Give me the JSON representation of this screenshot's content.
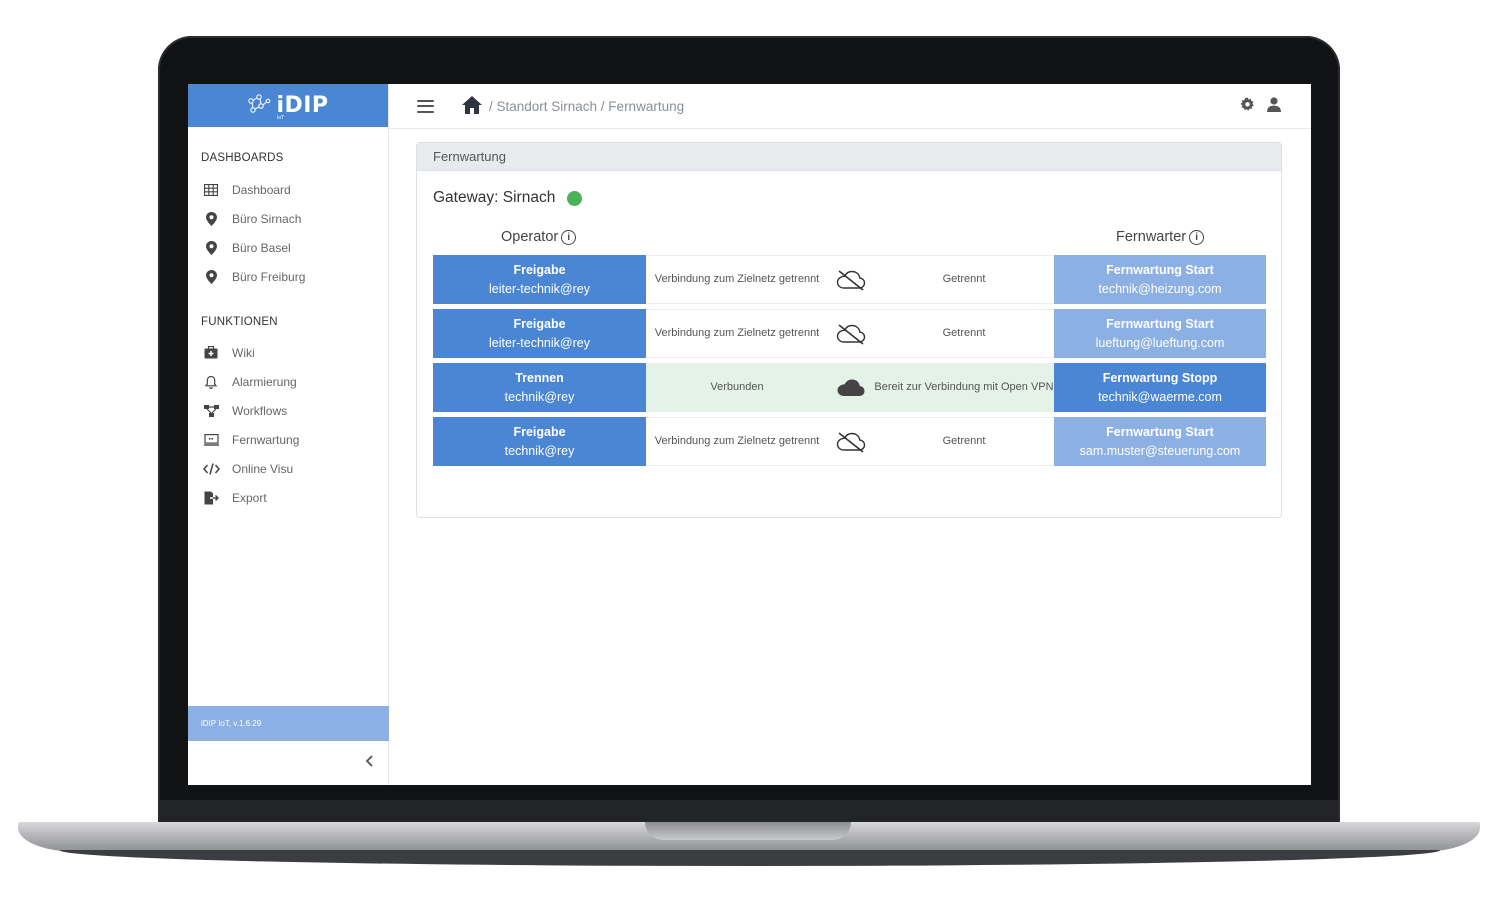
{
  "brand": {
    "name": "iDIP",
    "sub": "IoT"
  },
  "sidebar": {
    "dashboards_heading": "DASHBOARDS",
    "dashboards": [
      {
        "label": "Dashboard",
        "icon": "grid-icon"
      },
      {
        "label": "Büro Sirnach",
        "icon": "map-pin-icon"
      },
      {
        "label": "Büro Basel",
        "icon": "map-pin-icon"
      },
      {
        "label": "Büro Freiburg",
        "icon": "map-pin-icon"
      }
    ],
    "functions_heading": "FUNKTIONEN",
    "functions": [
      {
        "label": "Wiki",
        "icon": "medkit-icon"
      },
      {
        "label": "Alarmierung",
        "icon": "bell-icon"
      },
      {
        "label": "Workflows",
        "icon": "workflow-icon"
      },
      {
        "label": "Fernwartung",
        "icon": "remote-screen-icon"
      },
      {
        "label": "Online Visu",
        "icon": "code-icon"
      },
      {
        "label": "Export",
        "icon": "export-icon"
      }
    ],
    "version": "iDIP IoT, v.1.6.29",
    "collapse_icon": "chevron-left-icon"
  },
  "topbar": {
    "breadcrumb": "/ Standort Sirnach / Fernwartung"
  },
  "card": {
    "title": "Fernwartung",
    "gateway": "Gateway: Sirnach",
    "gateway_status_color": "#4cb25a",
    "operator_label": "Operator",
    "fernwarter_label": "Fernwarter",
    "rows": [
      {
        "op_action": "Freigabe",
        "op_user": "leiter-technik@rey",
        "status_left": "Verbindung zum Zielnetz getrennt",
        "cloud": "cloud-off-icon",
        "status_right": "Getrennt",
        "fw_action": "Fernwartung Start",
        "fw_user": "technik@heizung.com"
      },
      {
        "op_action": "Freigabe",
        "op_user": "leiter-technik@rey",
        "status_left": "Verbindung zum Zielnetz getrennt",
        "cloud": "cloud-off-icon",
        "status_right": "Getrennt",
        "fw_action": "Fernwartung Start",
        "fw_user": "lueftung@lueftung.com"
      },
      {
        "op_action": "Trennen",
        "op_user": "technik@rey",
        "status_left": "Verbunden",
        "cloud": "cloud-icon",
        "status_right": "Bereit zur Verbindung mit Open VPN",
        "fw_action": "Fernwartung Stopp",
        "fw_user": "technik@waerme.com"
      },
      {
        "op_action": "Freigabe",
        "op_user": "technik@rey",
        "status_left": "Verbindung zum Zielnetz getrennt",
        "cloud": "cloud-off-icon",
        "status_right": "Getrennt",
        "fw_action": "Fernwartung Start",
        "fw_user": "sam.muster@steuerung.com"
      }
    ]
  },
  "colors": {
    "primary": "#4a86d4",
    "primary_light": "#8cb0e3",
    "connected_bg": "#e4f2e8"
  }
}
